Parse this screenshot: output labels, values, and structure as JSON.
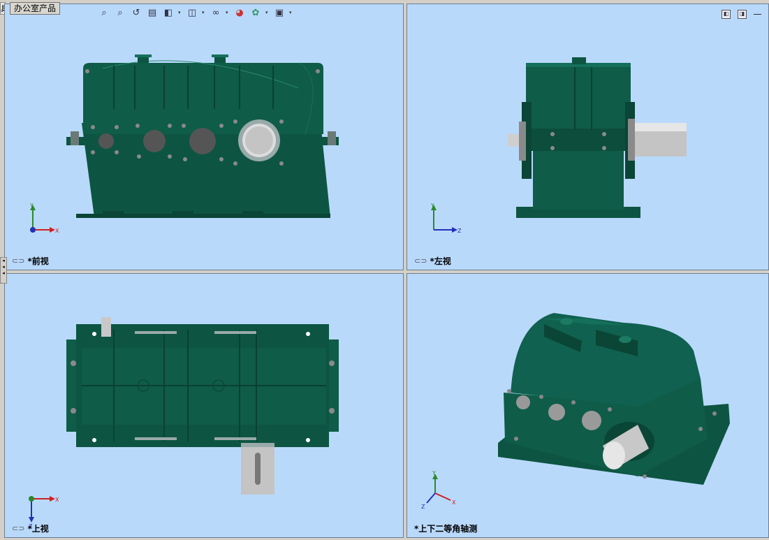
{
  "toolbar": {
    "tab_fragment": "具",
    "office_tab": "办公室产品",
    "hud_icons": [
      "zoom-to-fit-icon",
      "zoom-area-icon",
      "previous-view-icon",
      "section-view-icon",
      "view-orientation-icon",
      "display-style-icon",
      "hide-show-items-icon",
      "edit-appearance-icon",
      "apply-scene-icon",
      "view-settings-icon"
    ]
  },
  "views": {
    "front": {
      "label": "*前视",
      "axes": [
        "Y",
        "X"
      ]
    },
    "left": {
      "label": "*左视",
      "axes": [
        "Y",
        "Z"
      ]
    },
    "top": {
      "label": "*上视",
      "axes": [
        "X",
        "Z"
      ]
    },
    "iso": {
      "label": "*上下二等角轴测",
      "axes": [
        "Y",
        "X",
        "Z"
      ]
    }
  },
  "colors": {
    "viewport_bg": "#b9d9fb",
    "housing_green": "#0f5c48",
    "housing_dark": "#0a4536",
    "shaft_steel": "#c8c8c8"
  }
}
